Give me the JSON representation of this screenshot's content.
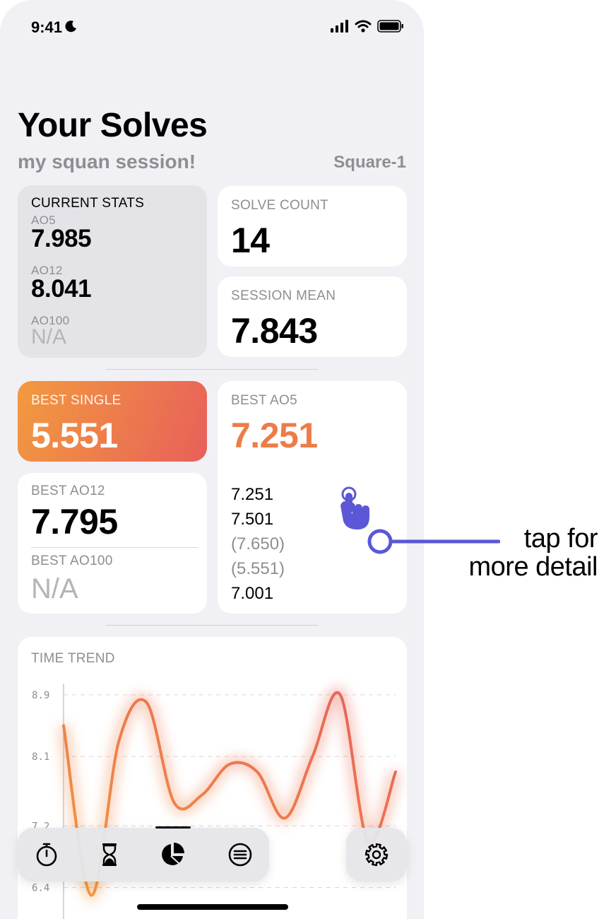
{
  "status_bar": {
    "time": "9:41"
  },
  "header": {
    "title": "Your Solves",
    "session_name": "my squan session!",
    "puzzle_type": "Square-1"
  },
  "current_stats": {
    "label": "CURRENT STATS",
    "ao5_label": "AO5",
    "ao5_value": "7.985",
    "ao12_label": "AO12",
    "ao12_value": "8.041",
    "ao100_label": "AO100",
    "ao100_value": "N/A"
  },
  "solve_count": {
    "label": "SOLVE COUNT",
    "value": "14"
  },
  "session_mean": {
    "label": "SESSION MEAN",
    "value": "7.843"
  },
  "best_single": {
    "label": "BEST SINGLE",
    "value": "5.551",
    "gradient_start": "#f29a3f",
    "gradient_end": "#e8605a"
  },
  "best_ao12": {
    "label": "BEST AO12",
    "value": "7.795"
  },
  "best_ao100": {
    "label": "BEST AO100",
    "value": "N/A"
  },
  "best_ao5": {
    "label": "BEST AO5",
    "value": "7.251",
    "times": [
      "7.251",
      "7.501",
      "(7.650)",
      "(5.551)",
      "7.001"
    ]
  },
  "callout": {
    "line1": "tap for",
    "line2": "more detail",
    "accent": "#5b57d6"
  },
  "time_trend": {
    "label": "TIME TREND"
  },
  "chart_data": {
    "type": "line",
    "title": "TIME TREND",
    "yticks": [
      "8.9",
      "8.1",
      "7.2",
      "6.4"
    ],
    "ylim": [
      5.8,
      9.1
    ],
    "series": [
      {
        "values": [
          8.5,
          6.3,
          8.3,
          8.8,
          7.5,
          7.6,
          8.0,
          7.9,
          7.3,
          8.1,
          8.9,
          7.0,
          7.9
        ]
      }
    ],
    "line_color_start": "#f29a3f",
    "line_color_end": "#e8605a",
    "grid": true
  },
  "tabbar": {
    "tabs": [
      "timer",
      "history",
      "stats",
      "sessions"
    ],
    "active": "stats",
    "settings": "settings"
  }
}
